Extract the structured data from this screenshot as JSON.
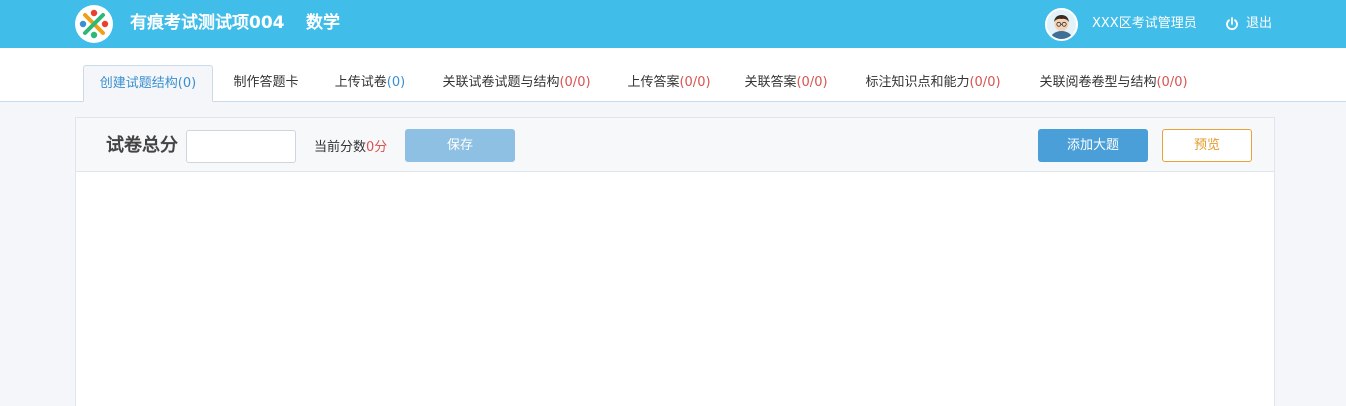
{
  "header": {
    "exam_title": "有痕考试测试项004",
    "subject": "数学",
    "user_name": "XXX区考试管理员",
    "logout_label": "退出",
    "logo_icon": "logo-pinwheel-icon",
    "avatar_icon": "user-avatar-icon",
    "logout_icon": "power-icon"
  },
  "tabs": [
    {
      "label": "创建试题结构",
      "count": "(0)",
      "count_color": "blue",
      "active": true
    },
    {
      "label": "制作答题卡",
      "count": "",
      "count_color": "",
      "active": false
    },
    {
      "label": "上传试卷",
      "count": "(0)",
      "count_color": "blue",
      "active": false
    },
    {
      "label": "关联试卷试题与结构",
      "count": "(0/0)",
      "count_color": "red",
      "active": false
    },
    {
      "label": "上传答案",
      "count": "(0/0)",
      "count_color": "red",
      "active": false
    },
    {
      "label": "关联答案",
      "count": "(0/0)",
      "count_color": "red",
      "active": false
    },
    {
      "label": "标注知识点和能力",
      "count": "(0/0)",
      "count_color": "red",
      "active": false
    },
    {
      "label": "关联阅卷卷型与结构",
      "count": "(0/0)",
      "count_color": "red",
      "active": false
    }
  ],
  "toolbar": {
    "total_label": "试卷总分",
    "total_value": "",
    "current_label": "当前分数",
    "current_value": "0分",
    "save_label": "保存",
    "add_label": "添加大题",
    "preview_label": "预览"
  },
  "colors": {
    "header_bg": "#41bdea",
    "accent_blue": "#3a8fd0",
    "count_red": "#d9534f",
    "preview_orange": "#e69a2a"
  }
}
